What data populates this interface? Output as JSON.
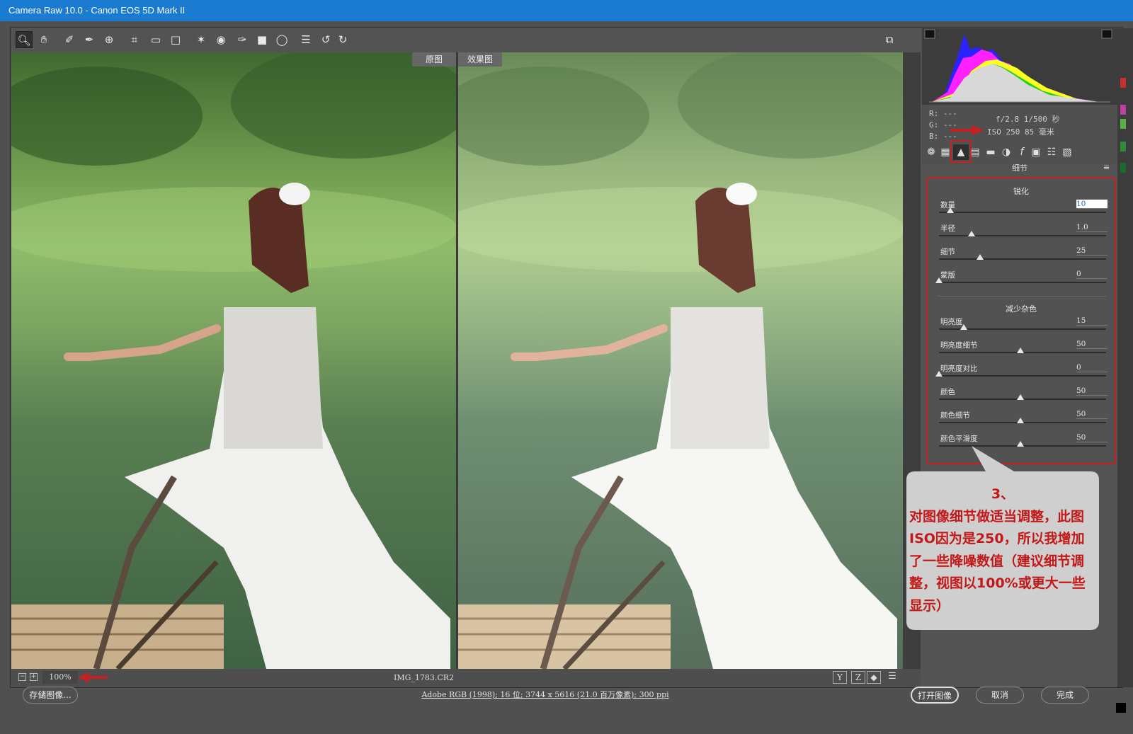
{
  "window": {
    "title": "Camera Raw 10.0 -  Canon EOS 5D Mark II"
  },
  "toolbar": {
    "tools": [
      "zoom-tool-icon",
      "hand-tool-icon",
      "white-balance-tool-icon",
      "color-sampler-icon",
      "targeted-adjustment-icon",
      "crop-tool-icon",
      "straighten-tool-icon",
      "transform-tool-icon",
      "spot-removal-icon",
      "red-eye-icon",
      "adjustment-brush-icon",
      "graduated-filter-icon",
      "radial-filter-icon",
      "preferences-icon",
      "rotate-ccw-icon",
      "rotate-cw-icon"
    ],
    "fullscreen_icon": "fullscreen-toggle-icon"
  },
  "preview": {
    "before_label": "原图",
    "after_label": "效果图"
  },
  "status": {
    "zoom": "100%",
    "filename": "IMG_1783.CR2"
  },
  "info": {
    "r": "R:  ---",
    "g": "G:  ---",
    "b": "B:  ---",
    "exposure": "f/2.8   1/500 秒",
    "iso_focal": "ISO 250   85 毫米"
  },
  "panel": {
    "title": "细节",
    "sharpening": {
      "title": "锐化",
      "sliders": [
        {
          "label": "数量",
          "value": "10",
          "level": 0.07
        },
        {
          "label": "半径",
          "value": "1.0",
          "level": 0.2
        },
        {
          "label": "细节",
          "value": "25",
          "level": 0.25
        },
        {
          "label": "蒙版",
          "value": "0",
          "level": 0.0
        }
      ]
    },
    "noise": {
      "title": "减少杂色",
      "sliders": [
        {
          "label": "明亮度",
          "value": "15",
          "level": 0.15
        },
        {
          "label": "明亮度细节",
          "value": "50",
          "level": 0.5
        },
        {
          "label": "明亮度对比",
          "value": "0",
          "level": 0.0
        },
        {
          "label": "颜色",
          "value": "50",
          "level": 0.5
        },
        {
          "label": "颜色细节",
          "value": "50",
          "level": 0.5
        },
        {
          "label": "颜色平滑度",
          "value": "50",
          "level": 0.5
        }
      ]
    }
  },
  "callout": {
    "lines": [
      "3、",
      "对图像细节做适当调整，此图",
      "ISO因为是250，所以我增加",
      "了一些降噪数值（建议细节调",
      "整，视图以100%或更大一些",
      "显示）"
    ]
  },
  "bottom": {
    "save": "存储图像...",
    "file_info": "Adobe RGB (1998); 16 位; 3744 x 5616 (21.0 百万像素); 300 ppi",
    "open": "打开图像",
    "cancel": "取消",
    "done": "完成"
  },
  "colors": {
    "accent_red": "#c41818",
    "title_blue": "#1b7bd0"
  }
}
